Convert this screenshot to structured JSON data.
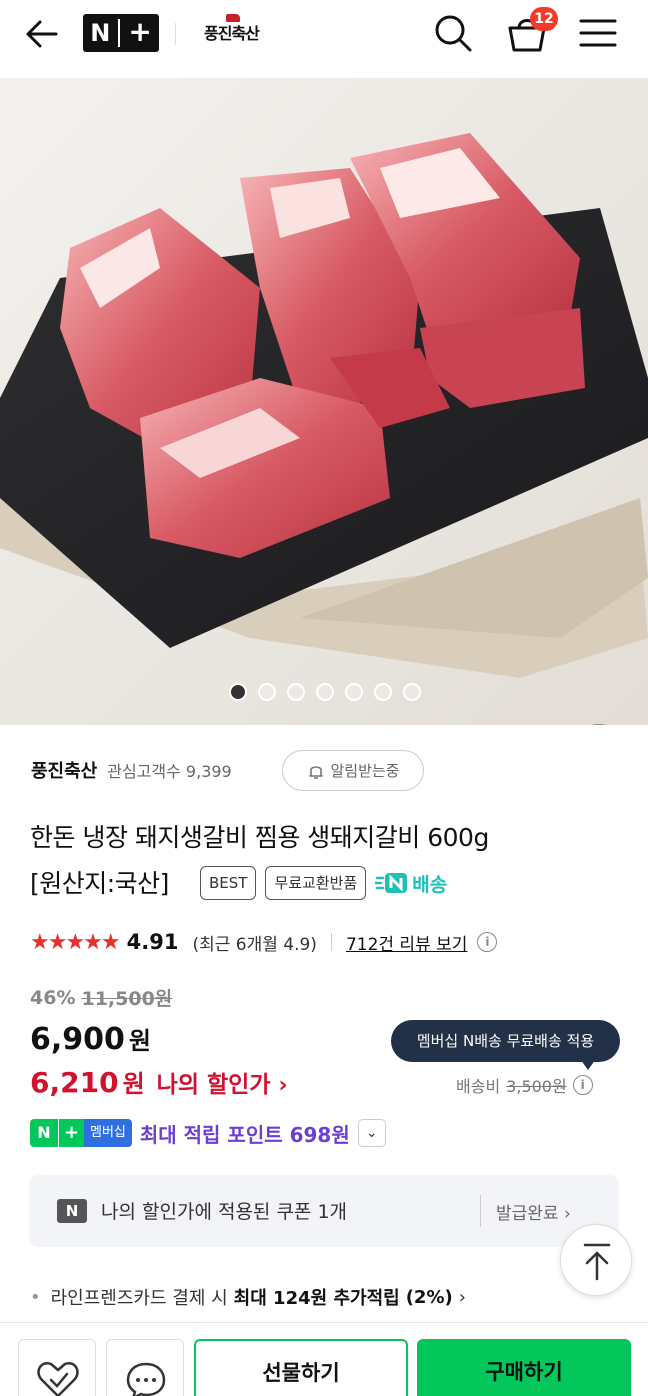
{
  "header": {
    "brand_logo_text": "풍진축산",
    "cart_count": "12",
    "icons": [
      "back-arrow-icon",
      "naver-plus-logo",
      "search-icon",
      "cart-icon",
      "menu-icon"
    ]
  },
  "gallery": {
    "image_alt": "Raw pork ribs on a black slate board",
    "total_images": 7,
    "active_index": 0
  },
  "store": {
    "name": "풍진축산",
    "followers_label": "관심고객수 9,399",
    "alert_button": "알림받는중"
  },
  "product": {
    "title_line1": "한돈 냉장 돼지생갈비 찜용 생돼지갈비 600g",
    "title_line2": "[원산지:국산]",
    "tags": [
      "BEST",
      "무료교환반품"
    ],
    "delivery_badge": "배송"
  },
  "rating": {
    "stars": "★★★★★",
    "value": "4.91",
    "recent": "(최근 6개월 4.9)",
    "review_link": "712건 리뷰 보기"
  },
  "price": {
    "discount_pct": "46%",
    "original": "11,500원",
    "current": "6,900",
    "currency": "원",
    "my_price": "6,210",
    "my_price_label": "나의 할인가",
    "membership_bubble": "멤버십 N배송 무료배송 적용",
    "shipping_label": "배송비",
    "shipping_old": "3,500원"
  },
  "points": {
    "badge_n": "N",
    "badge_plus": "+",
    "badge_text": "멤버십",
    "text": "최대 적립 포인트 698원"
  },
  "coupon": {
    "text": "나의 할인가에 적용된 쿠폰 1개",
    "status": "발급완료"
  },
  "card_benefit": {
    "prefix": "라인프렌즈카드 결제 시",
    "bold": "최대 124원 추가적립",
    "suffix": "(2%)"
  },
  "bottom_bar": {
    "gift_label": "선물하기",
    "buy_label": "구매하기"
  },
  "colors": {
    "naver_green": "#03c75a",
    "price_red": "#d1112e",
    "point_purple": "#6b3fd1",
    "bubble_navy": "#223048"
  }
}
